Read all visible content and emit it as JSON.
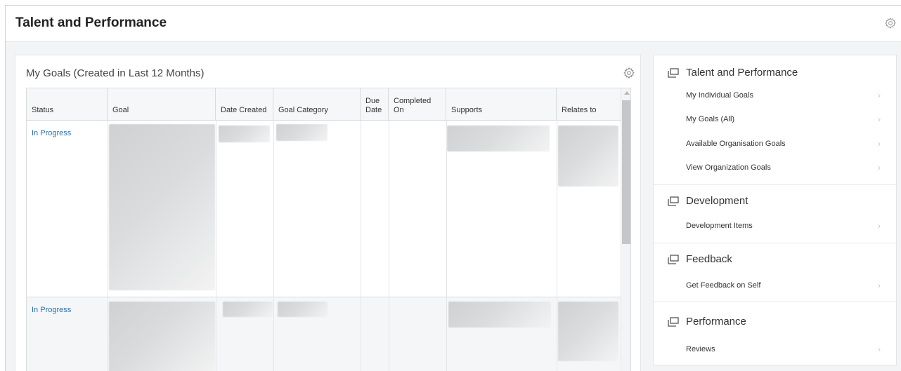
{
  "page": {
    "title": "Talent and Performance"
  },
  "goals": {
    "title": "My Goals (Created in Last 12 Months)",
    "columns": [
      "Status",
      "Goal",
      "Date Created",
      "Goal Category",
      "Due Date",
      "Completed On",
      "Supports",
      "Relates to"
    ],
    "rows": [
      {
        "status": "In Progress"
      },
      {
        "status": "In Progress"
      }
    ]
  },
  "nav": {
    "sections": [
      {
        "heading": "Talent and Performance",
        "items": [
          "My Individual Goals",
          "My Goals (All)",
          "Available Organisation Goals",
          "View Organization Goals"
        ]
      },
      {
        "heading": "Development",
        "items": [
          "Development Items"
        ]
      },
      {
        "heading": "Feedback",
        "items": [
          "Get Feedback on Self"
        ]
      },
      {
        "heading": "Performance",
        "items": [
          "Reviews"
        ]
      }
    ],
    "chevron": "›"
  },
  "icons": {
    "gear": "gear-icon",
    "section": "window-stack-icon",
    "chevron": "chevron-right-icon"
  },
  "colors": {
    "link": "#2a6fb3",
    "background": "#f2f4f5"
  }
}
